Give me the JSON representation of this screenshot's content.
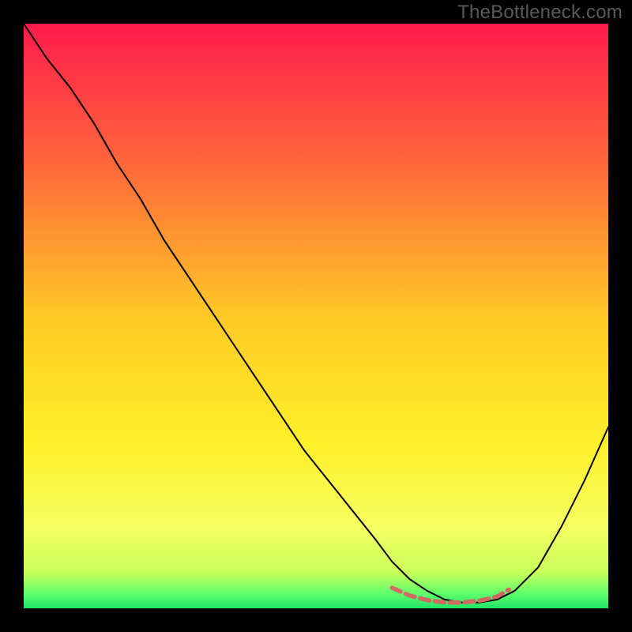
{
  "watermark": "TheBottleneck.com",
  "chart_data": {
    "type": "line",
    "title": "",
    "xlabel": "",
    "ylabel": "",
    "xlim": [
      0,
      100
    ],
    "ylim": [
      0,
      100
    ],
    "grid": false,
    "legend": false,
    "background_gradient_stops": [
      {
        "offset": 0.0,
        "color": "#ff1b4b"
      },
      {
        "offset": 0.25,
        "color": "#ff6a3a"
      },
      {
        "offset": 0.5,
        "color": "#ffc925"
      },
      {
        "offset": 0.72,
        "color": "#fff02a"
      },
      {
        "offset": 0.86,
        "color": "#f6ff63"
      },
      {
        "offset": 0.94,
        "color": "#c7ff5a"
      },
      {
        "offset": 0.975,
        "color": "#5eff6a"
      },
      {
        "offset": 1.0,
        "color": "#21e36a"
      }
    ],
    "series": [
      {
        "name": "bottleneck-curve",
        "stroke": "#000000",
        "stroke_width": 2.0,
        "x": [
          0,
          4,
          8,
          12,
          16,
          20,
          24,
          28,
          32,
          36,
          40,
          44,
          48,
          52,
          56,
          60,
          63,
          66,
          69,
          72,
          75,
          78,
          81,
          84,
          88,
          92,
          96,
          100
        ],
        "y": [
          100,
          94,
          89,
          83,
          76,
          70,
          63,
          57,
          51,
          45,
          39,
          33,
          27,
          22,
          17,
          12,
          8,
          5,
          3,
          1.5,
          1,
          1,
          1.5,
          3,
          7,
          14,
          22,
          31
        ]
      },
      {
        "name": "optimal-marker",
        "stroke": "#d06a62",
        "stroke_width": 5.5,
        "dash": "12 7",
        "x": [
          63,
          66,
          69,
          72,
          75,
          78,
          81,
          83
        ],
        "y": [
          3.5,
          2.2,
          1.4,
          1.0,
          1.0,
          1.3,
          2.0,
          3.2
        ]
      }
    ]
  }
}
